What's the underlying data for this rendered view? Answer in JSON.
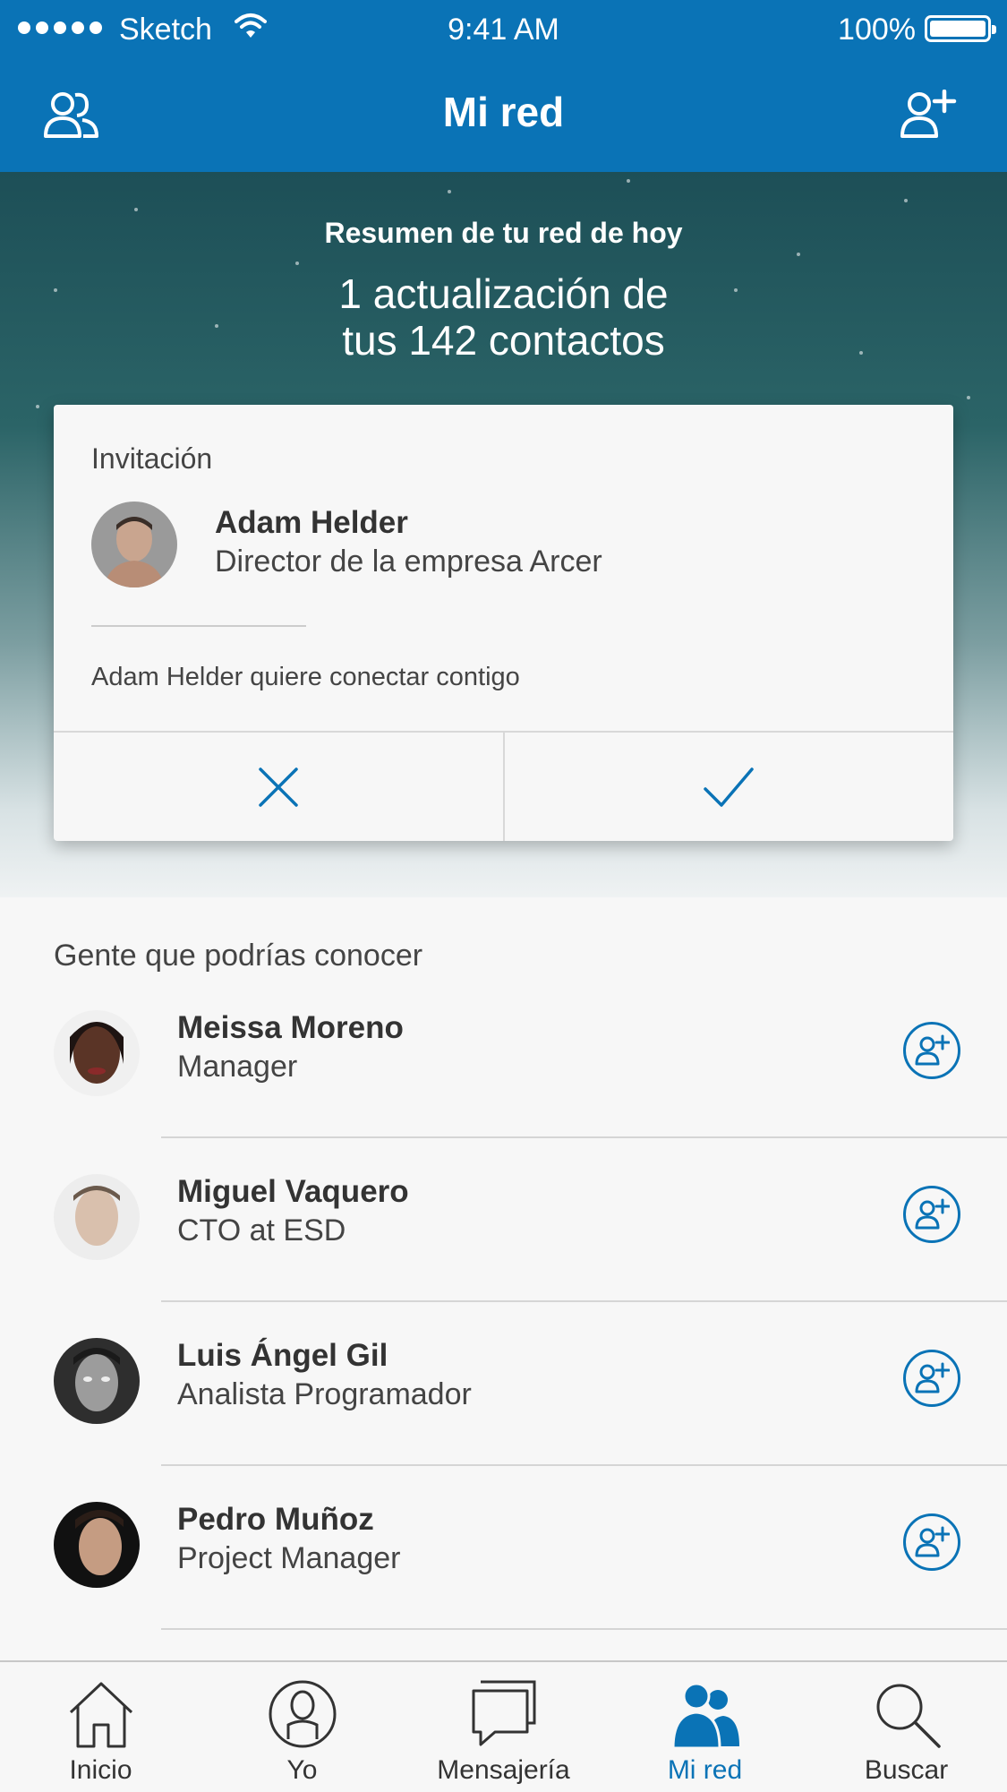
{
  "status_bar": {
    "carrier": "Sketch",
    "time": "9:41 AM",
    "battery": "100%"
  },
  "header": {
    "title": "Mi red",
    "left_icon": "people-icon",
    "right_icon": "add-person-icon"
  },
  "summary": {
    "subtitle": "Resumen de tu red de hoy",
    "line1": "1 actualización de",
    "line2": "tus 142 contactos"
  },
  "invitation": {
    "title": "Invitación",
    "name": "Adam Helder",
    "role": "Director  de la empresa Arcer",
    "message": "Adam Helder quiere conectar contigo",
    "decline_icon": "close-icon",
    "accept_icon": "check-icon"
  },
  "suggestions": {
    "title": "Gente que podrías conocer",
    "people": [
      {
        "name": "Meissa Moreno",
        "role": "Manager"
      },
      {
        "name": "Miguel Vaquero",
        "role": "CTO at ESD"
      },
      {
        "name": "Luis Ángel Gil",
        "role": "Analista Programador"
      },
      {
        "name": "Pedro Muñoz",
        "role": "Project Manager"
      }
    ]
  },
  "tabs": [
    {
      "label": "Inicio",
      "icon": "home-icon"
    },
    {
      "label": "Yo",
      "icon": "profile-icon"
    },
    {
      "label": "Mensajería",
      "icon": "messages-icon"
    },
    {
      "label": "Mi red",
      "icon": "network-icon",
      "active": true
    },
    {
      "label": "Buscar",
      "icon": "search-icon"
    }
  ],
  "colors": {
    "accent": "#0a73b6",
    "background": "#f7f7f7"
  }
}
